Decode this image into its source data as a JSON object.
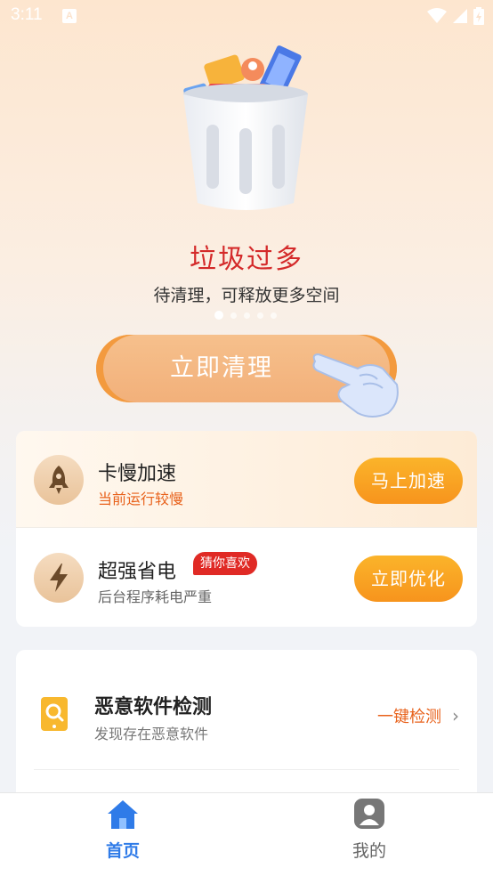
{
  "status_bar": {
    "time": "3:11",
    "notification_glyph": "A",
    "icons": [
      "wifi-icon",
      "signal-icon",
      "battery-icon"
    ]
  },
  "hero": {
    "title": "垃圾过多",
    "subtitle": "待清理，可释放更多空间",
    "dots_total": 5,
    "dots_active": 0,
    "clean_button": "立即清理"
  },
  "features": [
    {
      "title": "卡慢加速",
      "subtitle": "当前运行较慢",
      "action": "马上加速",
      "icon": "rocket-icon"
    },
    {
      "title": "超强省电",
      "tag": "猜你喜欢",
      "subtitle": "后台程序耗电严重",
      "action": "立即优化",
      "icon": "lightning-icon"
    }
  ],
  "malware": {
    "title": "恶意软件检测",
    "subtitle": "发现存在恶意软件",
    "action": "一键检测",
    "icon": "phone-scan-icon"
  },
  "nav": [
    {
      "label": "首页",
      "icon": "home-icon",
      "active": true
    },
    {
      "label": "我的",
      "icon": "user-icon",
      "active": false
    }
  ],
  "colors": {
    "accent": "#f7941d",
    "danger": "#e02a25",
    "nav_active": "#2f7be8",
    "title_red": "#d42a2a"
  }
}
